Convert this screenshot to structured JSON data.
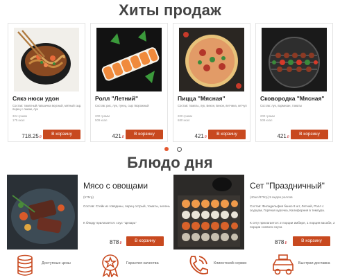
{
  "hits": {
    "heading": "Хиты продаж",
    "items": [
      {
        "title": "Сякэ нюси удон",
        "desc": "Состав: томатный лапшичка вкусный, мятный сыр, перец с лаком, лук",
        "meta1": "324 грамм",
        "meta2": "175 ккал",
        "price": "718.25",
        "currency": "₽",
        "button": "В корзину"
      },
      {
        "title": "Ролл \"Летний\"",
        "desc": "Состав: рис, лук, тунец, сыр творожный",
        "meta1": "200 грамм",
        "meta2": "509 ккал",
        "price": "421",
        "currency": "₽",
        "button": "В корзину"
      },
      {
        "title": "Пицца \"Мясная\"",
        "desc": "Состав: томаты, лук, Бекон, Бекон, ветчина, кетчуп",
        "meta1": "200 грамм",
        "meta2": "680 ккал",
        "price": "421",
        "currency": "₽",
        "button": "В корзину"
      },
      {
        "title": "Сковородка \"Мясная\"",
        "desc": "Состав: лук, пармезан, томаты",
        "meta1": "200 грамм",
        "meta2": "509 ккал",
        "price": "421",
        "currency": "₽",
        "button": "В корзину"
      }
    ]
  },
  "dish": {
    "heading": "Блюдо дня",
    "items": [
      {
        "name": "Мясо с овощами",
        "weight": "(575гр)",
        "comp": "Состав: Стейк из говядины, перец острый, томаты, зелень",
        "extra": "К блюду прилагается: соус \"Цезарь\"",
        "price": "878",
        "currency": "₽",
        "button": "В корзину"
      },
      {
        "name": "Сет \"Праздничный\"",
        "weight": "(40шт/870гр) 5 видов роллов",
        "comp": "Состав: Филадельфия банко 8 шт, Летний, Ролл с огурцом, Горячая курочка, Калифорния в темпура.",
        "extra": "К сету прилагается: 2 порции имбиря, 1 порция васаби, 2 порции соевого соуса",
        "price": "878",
        "currency": "₽",
        "button": "В корзину"
      }
    ]
  },
  "features": [
    {
      "icon": "coins-icon",
      "label": "Доступные цены"
    },
    {
      "icon": "medal-icon",
      "label": "Гарантия качества"
    },
    {
      "icon": "phone-icon",
      "label": "Клиентский сервис"
    },
    {
      "icon": "delivery-car-icon",
      "label": "Быстрая доставка"
    }
  ],
  "colors": {
    "accent": "#c8491f",
    "dot_active": "#e4572e"
  }
}
